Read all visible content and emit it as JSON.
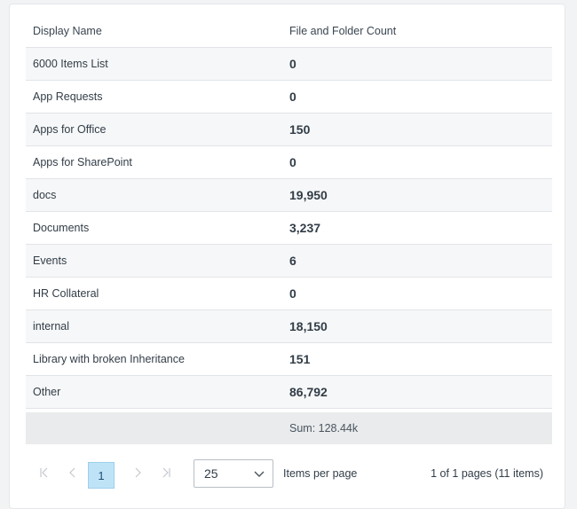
{
  "table": {
    "columns": {
      "name": "Display Name",
      "count": "File and Folder Count"
    },
    "rows": [
      {
        "name": "6000 Items List",
        "count": "0"
      },
      {
        "name": "App Requests",
        "count": "0"
      },
      {
        "name": "Apps for Office",
        "count": "150"
      },
      {
        "name": "Apps for SharePoint",
        "count": "0"
      },
      {
        "name": "docs",
        "count": "19,950"
      },
      {
        "name": "Documents",
        "count": "3,237"
      },
      {
        "name": "Events",
        "count": "6"
      },
      {
        "name": "HR Collateral",
        "count": "0"
      },
      {
        "name": "internal",
        "count": "18,150"
      },
      {
        "name": "Library with broken Inheritance",
        "count": "151"
      },
      {
        "name": "Other",
        "count": "86,792"
      }
    ],
    "footer": {
      "sum": "Sum: 128.44k"
    }
  },
  "pager": {
    "current_page": "1",
    "page_size": "25",
    "items_per_page_label": "Items per page",
    "info": "1 of 1 pages (11 items)"
  },
  "icons": {
    "first": "first-page-icon",
    "prev": "previous-page-icon",
    "next": "next-page-icon",
    "last": "last-page-icon",
    "dropdown": "chevron-down-icon"
  }
}
